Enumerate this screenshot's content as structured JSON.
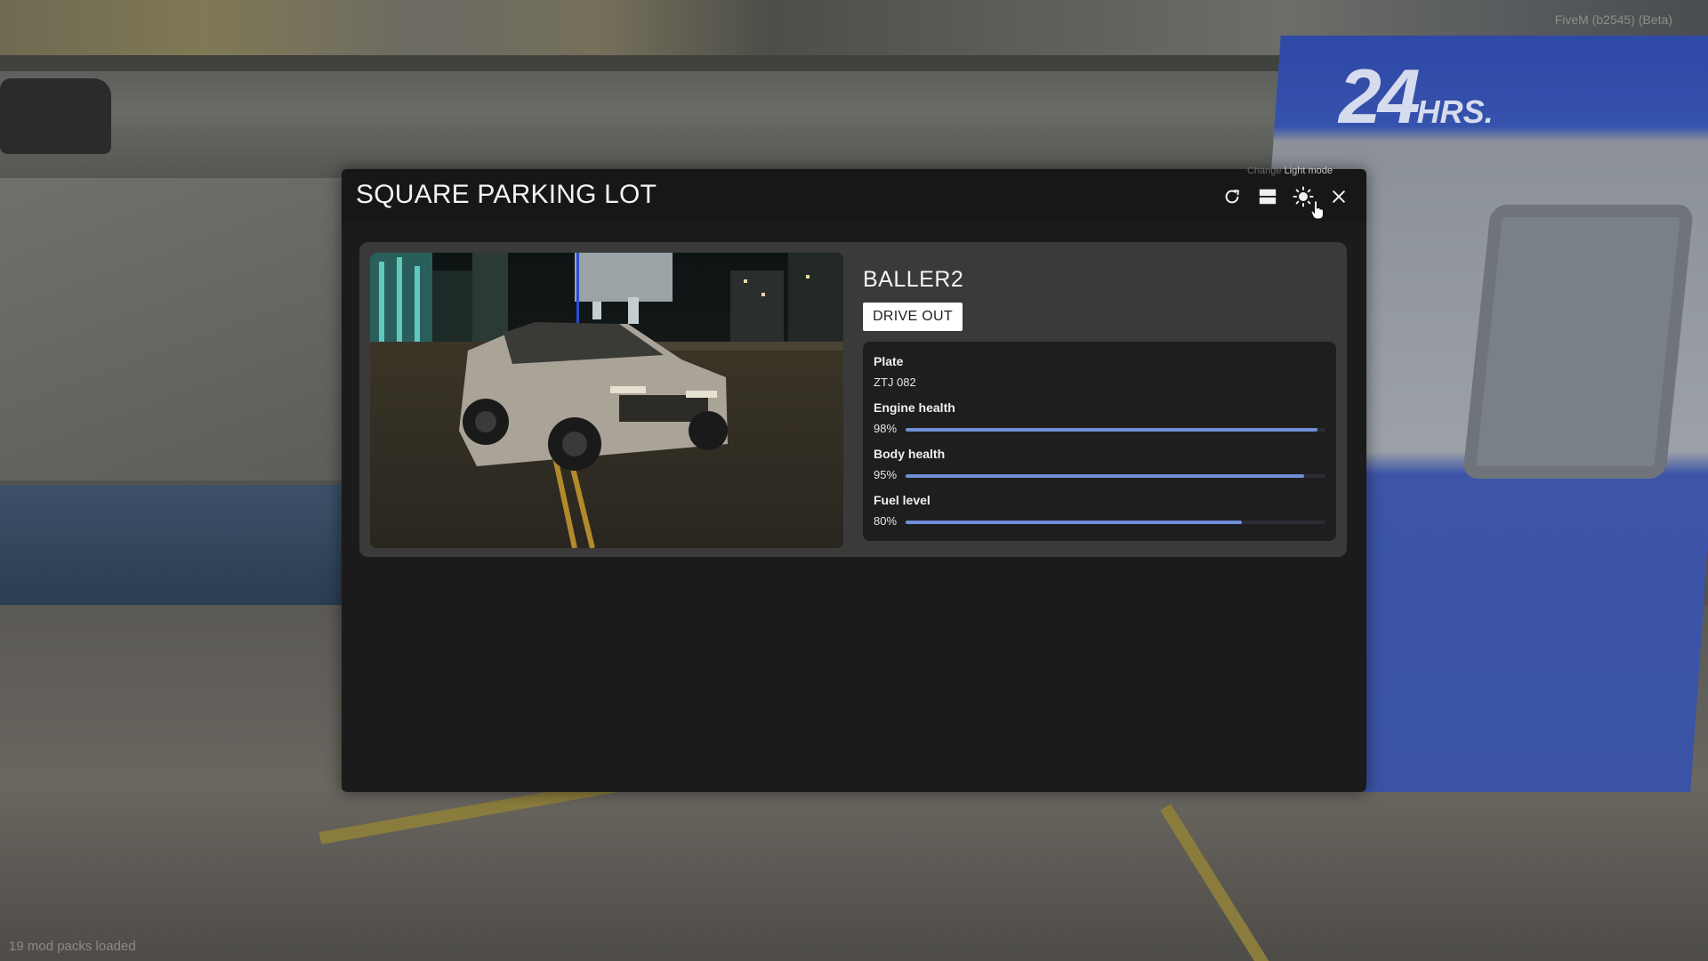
{
  "hud": {
    "server_tag": "FiveM (b2545) (Beta)",
    "mod_status": "19 mod packs loaded",
    "booth_sign_main": "24",
    "booth_sign_small": "HRS."
  },
  "garage": {
    "title": "SQUARE PARKING LOT",
    "tooltip_prefix": "Change",
    "tooltip_value": "Light mode",
    "toolbar": {
      "refresh_icon": "refresh-icon",
      "layout_icon": "list-layout-icon",
      "theme_icon": "sun-icon",
      "close_icon": "close-icon"
    },
    "accent_color": "#6f8ed8",
    "vehicles": [
      {
        "model": "BALLER2",
        "action_label": "DRIVE OUT",
        "plate_label": "Plate",
        "plate": "ZTJ 082",
        "stats": [
          {
            "label": "Engine health",
            "value_text": "98%",
            "value": 0.98
          },
          {
            "label": "Body health",
            "value_text": "95%",
            "value": 0.95
          },
          {
            "label": "Fuel level",
            "value_text": "80%",
            "value": 0.8
          }
        ]
      }
    ]
  }
}
